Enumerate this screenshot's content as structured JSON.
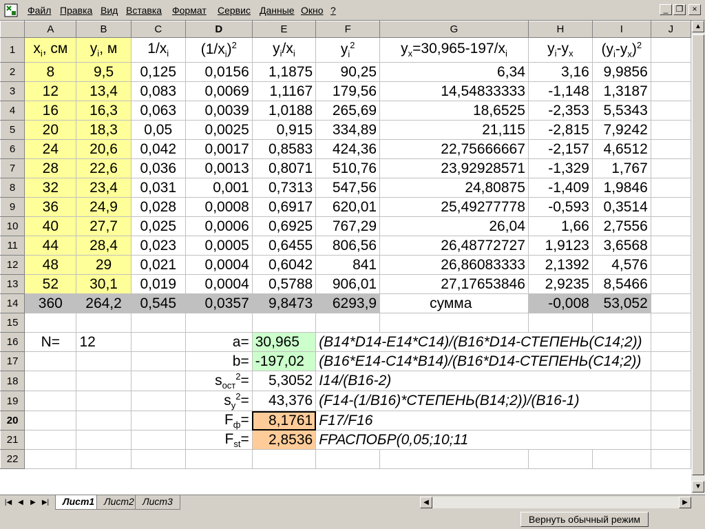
{
  "menu": {
    "items": [
      "Файл",
      "Правка",
      "Вид",
      "Вставка",
      "Формат",
      "Сервис",
      "Данные",
      "Окно",
      "?"
    ]
  },
  "window_controls": {
    "minimize": "_",
    "restore": "❐",
    "close": "×"
  },
  "columns": [
    "A",
    "B",
    "C",
    "D",
    "E",
    "F",
    "G",
    "H",
    "I",
    "J"
  ],
  "header_row": {
    "a": "x",
    "a_sub": "i",
    "a_tail": ", см",
    "b": "y",
    "b_sub": "i",
    "b_tail": ", м",
    "c": "1/x",
    "c_sub": "i",
    "d": "(1/x",
    "d_sub": "i",
    "d_close": ")",
    "d_sup": "2",
    "e_y": "y",
    "e_ysub": "i",
    "e_x": "/x",
    "e_xsub": "i",
    "f": "y",
    "f_sub": "i",
    "f_sup": "2",
    "g_y": "y",
    "g_ysub": "x",
    "g_mid": "=30,965-197/x",
    "g_sub": "i",
    "h_y": "y",
    "h_ysub": "i",
    "h_mid": "-y",
    "h_sub": "x",
    "i_open": "(y",
    "i_sub1": "i",
    "i_mid": "-y",
    "i_sub2": "x",
    "i_close": ")",
    "i_sup": "2"
  },
  "rows": [
    [
      "8",
      "9,5",
      "0,125",
      "0,0156",
      "1,1875",
      "90,25",
      "6,34",
      "3,16",
      "9,9856"
    ],
    [
      "12",
      "13,4",
      "0,083",
      "0,0069",
      "1,1167",
      "179,56",
      "14,54833333",
      "-1,148",
      "1,3187"
    ],
    [
      "16",
      "16,3",
      "0,063",
      "0,0039",
      "1,0188",
      "265,69",
      "18,6525",
      "-2,353",
      "5,5343"
    ],
    [
      "20",
      "18,3",
      "0,05",
      "0,0025",
      "0,915",
      "334,89",
      "21,115",
      "-2,815",
      "7,9242"
    ],
    [
      "24",
      "20,6",
      "0,042",
      "0,0017",
      "0,8583",
      "424,36",
      "22,75666667",
      "-2,157",
      "4,6512"
    ],
    [
      "28",
      "22,6",
      "0,036",
      "0,0013",
      "0,8071",
      "510,76",
      "23,92928571",
      "-1,329",
      "1,767"
    ],
    [
      "32",
      "23,4",
      "0,031",
      "0,001",
      "0,7313",
      "547,56",
      "24,80875",
      "-1,409",
      "1,9846"
    ],
    [
      "36",
      "24,9",
      "0,028",
      "0,0008",
      "0,6917",
      "620,01",
      "25,49277778",
      "-0,593",
      "0,3514"
    ],
    [
      "40",
      "27,7",
      "0,025",
      "0,0006",
      "0,6925",
      "767,29",
      "26,04",
      "1,66",
      "2,7556"
    ],
    [
      "44",
      "28,4",
      "0,023",
      "0,0005",
      "0,6455",
      "806,56",
      "26,48772727",
      "1,9123",
      "3,6568"
    ],
    [
      "48",
      "29",
      "0,021",
      "0,0004",
      "0,6042",
      "841",
      "26,86083333",
      "2,1392",
      "4,576"
    ],
    [
      "52",
      "30,1",
      "0,019",
      "0,0004",
      "0,5788",
      "906,01",
      "27,17653846",
      "2,9235",
      "8,5466"
    ]
  ],
  "sum_row": [
    "360",
    "264,2",
    "0,545",
    "0,0357",
    "9,8473",
    "6293,9",
    "сумма",
    "-0,008",
    "53,052"
  ],
  "stats": {
    "n_label": "N=",
    "n_value": "12",
    "a_label": "a=",
    "a_value": "30,965",
    "a_formula": "(B14*D14-E14*C14)/(B16*D14-СТЕПЕНЬ(C14;2))",
    "b_label": "b=",
    "b_value": "-197,02",
    "b_formula": "(B16*E14-C14*B14)/(B16*D14-СТЕПЕНЬ(C14;2))",
    "s_ost": "s",
    "s_ost_sub": "ост",
    "s_ost_sup": "2",
    "s_ost_eq": "=",
    "s_ost_value": "5,3052",
    "s_ost_formula": "I14/(B16-2)",
    "s_y": "s",
    "s_y_sub": "y",
    "s_y_sup": "2",
    "s_y_eq": "=",
    "s_y_value": "43,376",
    "s_y_formula": "(F14-(1/B16)*СТЕПЕНЬ(B14;2))/(B16-1)",
    "f_ph": "F",
    "f_ph_sub": "ф",
    "f_ph_eq": "=",
    "f_ph_value": "8,1761",
    "f_ph_formula": "F17/F16",
    "f_st": "F",
    "f_st_sub": "st",
    "f_st_eq": "=",
    "f_st_value": "2,8536",
    "f_st_formula": "FРАСПОБР(0,05;10;11"
  },
  "row_numbers": [
    "1",
    "2",
    "3",
    "4",
    "5",
    "6",
    "7",
    "8",
    "9",
    "10",
    "11",
    "12",
    "13",
    "14",
    "15",
    "16",
    "17",
    "18",
    "19",
    "20",
    "21",
    "22"
  ],
  "tabs": [
    "Лист1",
    "Лист2",
    "Лист3"
  ],
  "status": {
    "button": "Вернуть обычный режим"
  },
  "colors": {
    "yellow": "#ffff99",
    "gray": "#c0c0c0",
    "green": "#ccffcc",
    "orange": "#ffcc99"
  }
}
